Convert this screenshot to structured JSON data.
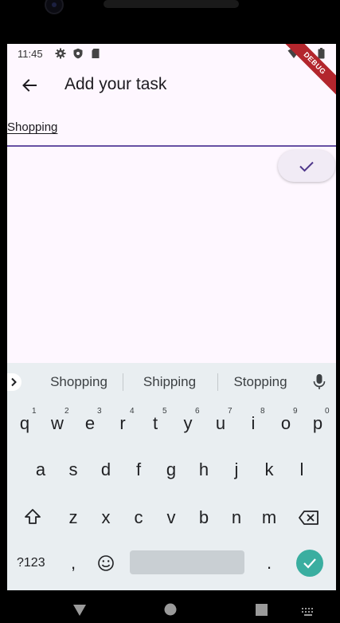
{
  "status": {
    "time": "11:45",
    "debug_banner": "DEBUG"
  },
  "appbar": {
    "title": "Add your task"
  },
  "task_field": {
    "value": "Shopping"
  },
  "keyboard": {
    "suggestions": [
      "Shopping",
      "Shipping",
      "Stopping"
    ],
    "row1": [
      "q",
      "w",
      "e",
      "r",
      "t",
      "y",
      "u",
      "i",
      "o",
      "p"
    ],
    "row1_hints": [
      "1",
      "2",
      "3",
      "4",
      "5",
      "6",
      "7",
      "8",
      "9",
      "0"
    ],
    "row2": [
      "a",
      "s",
      "d",
      "f",
      "g",
      "h",
      "j",
      "k",
      "l"
    ],
    "row3": [
      "z",
      "x",
      "c",
      "v",
      "b",
      "n",
      "m"
    ],
    "symbols_key": "?123",
    "comma_key": ",",
    "period_key": "."
  },
  "colors": {
    "accent": "#6750a4",
    "enter_key": "#3aaea0",
    "background": "#fef7ff"
  }
}
